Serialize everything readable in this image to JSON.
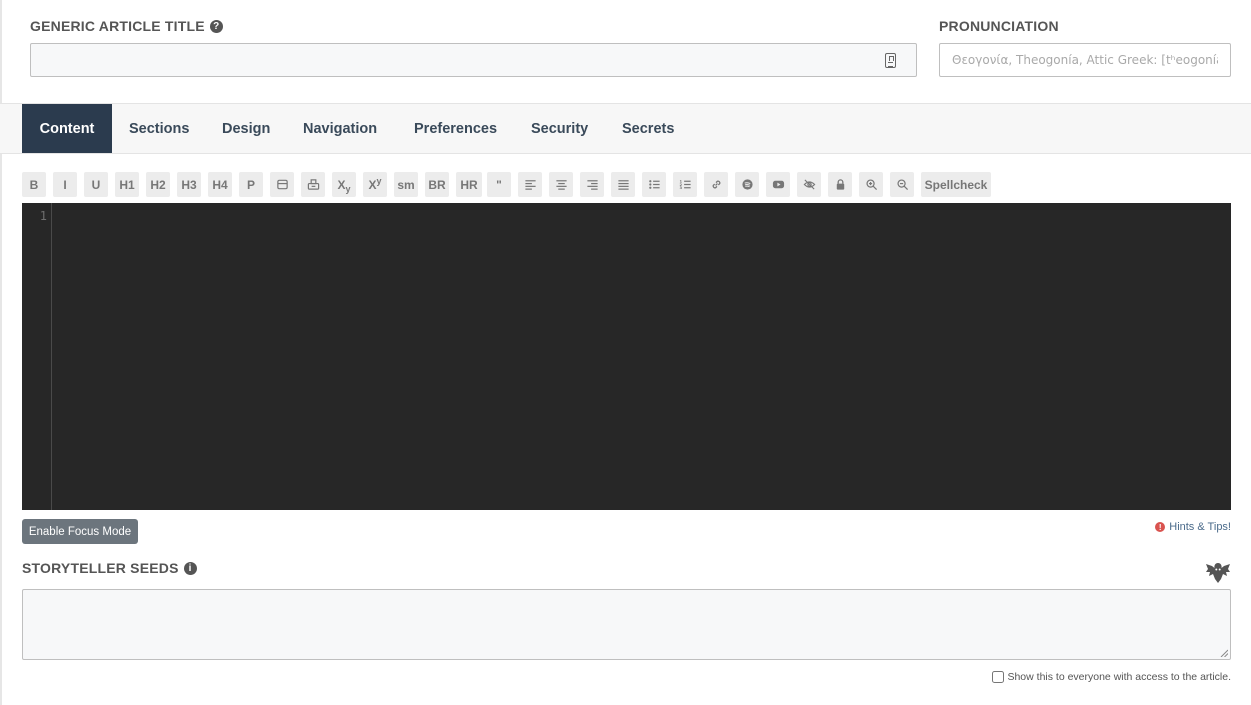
{
  "title_field": {
    "label": "GENERIC ARTICLE TITLE",
    "help_icon": "question-circle-icon",
    "value": "",
    "counter_icon": "character-counter-icon"
  },
  "pronunciation_field": {
    "label": "PRONUNCIATION",
    "placeholder": "Θεογονία, Theogonía, Attic Greek: [tʰeogoníaː]"
  },
  "tabs": [
    {
      "label": "Content",
      "active": true
    },
    {
      "label": "Sections",
      "active": false
    },
    {
      "label": "Design",
      "active": false
    },
    {
      "label": "Navigation",
      "active": false
    },
    {
      "label": "Preferences",
      "active": false
    },
    {
      "label": "Security",
      "active": false
    },
    {
      "label": "Secrets",
      "active": false
    }
  ],
  "toolbar": {
    "bold": "B",
    "italic": "I",
    "underline": "U",
    "h1": "H1",
    "h2": "H2",
    "h3": "H3",
    "h4": "H4",
    "paragraph": "P",
    "subscript_base": "X",
    "subscript_sub": "y",
    "superscript_base": "X",
    "superscript_sup": "y",
    "small": "sm",
    "br": "BR",
    "hr": "HR",
    "quote": "\"",
    "spellcheck": "Spellcheck"
  },
  "editor": {
    "line_number": "1",
    "content": ""
  },
  "focus_mode_button": "Enable Focus Mode",
  "hints": {
    "label": "Hints & Tips!",
    "icon": "exclamation-circle-icon",
    "color": "#d9534f"
  },
  "seeds_field": {
    "label": "STORYTELLER SEEDS",
    "info_icon": "info-circle-icon",
    "value": "",
    "mascot_icon": "dragon-icon"
  },
  "share_checkbox": {
    "label": "Show this to everyone with access to the article.",
    "checked": false
  },
  "colors": {
    "active_tab_bg": "#2b3b4e",
    "editor_bg": "#272727",
    "focus_button_bg": "#6c757d"
  }
}
